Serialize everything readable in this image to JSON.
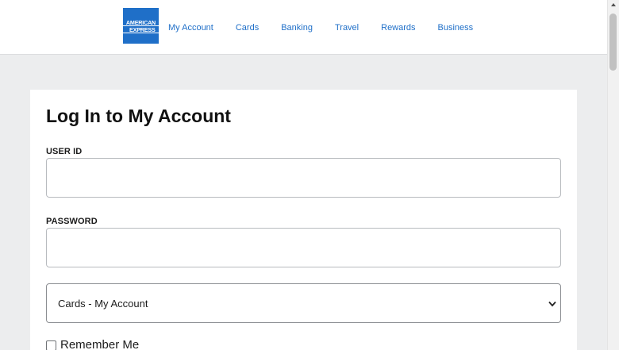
{
  "header": {
    "logo": {
      "line1": "AMERICAN",
      "line2": "EXPRESS",
      "color": "#1f6fc8"
    },
    "nav": [
      "My Account",
      "Cards",
      "Banking",
      "Travel",
      "Rewards",
      "Business"
    ]
  },
  "login": {
    "title": "Log In to My Account",
    "user_id_label": "USER ID",
    "user_id_value": "",
    "password_label": "PASSWORD",
    "password_value": "",
    "account_type_selected": "Cards - My Account",
    "remember_me_label": "Remember Me",
    "remember_me_checked": false
  },
  "colors": {
    "link": "#1f6fc8",
    "background": "#ecedee"
  }
}
